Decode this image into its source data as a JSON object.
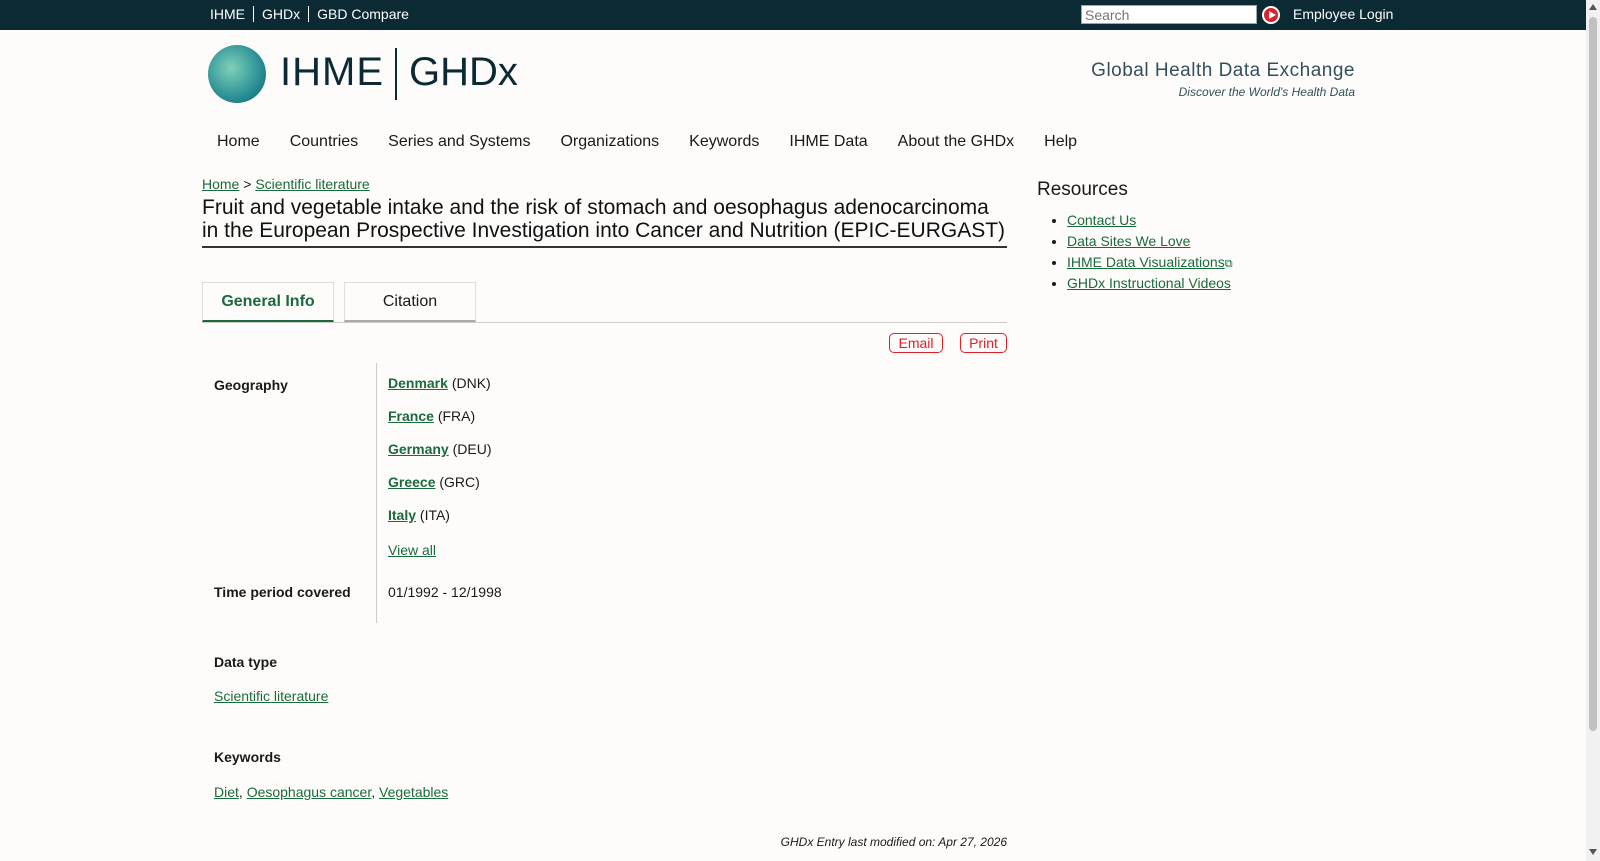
{
  "topbar": {
    "links": [
      "IHME",
      "GHDx",
      "GBD Compare"
    ],
    "search_placeholder": "Search",
    "login": "Employee Login"
  },
  "header": {
    "logo_ihme": "IHME",
    "logo_ghdx": "GHDx",
    "tagline": "Global Health Data Exchange",
    "subtagline": "Discover the World's Health Data"
  },
  "nav": [
    "Home",
    "Countries",
    "Series and Systems",
    "Organizations",
    "Keywords",
    "IHME Data",
    "About the GHDx",
    "Help"
  ],
  "breadcrumb": {
    "home": "Home",
    "sep": ">",
    "section": "Scientific literature"
  },
  "title": "Fruit and vegetable intake and the risk of stomach and oesophagus adenocarcinoma in the European Prospective Investigation into Cancer and Nutrition (EPIC-EURGAST)",
  "tabs": [
    "General Info",
    "Citation"
  ],
  "actions": {
    "email": "Email",
    "print": "Print"
  },
  "info": {
    "geography_label": "Geography",
    "geography": [
      {
        "name": "Denmark",
        "code": "(DNK)"
      },
      {
        "name": "France",
        "code": "(FRA)"
      },
      {
        "name": "Germany",
        "code": "(DEU)"
      },
      {
        "name": "Greece",
        "code": "(GRC)"
      },
      {
        "name": "Italy",
        "code": "(ITA)"
      }
    ],
    "view_all": "View all",
    "time_label": "Time period covered",
    "time_value": "01/1992 - 12/1998",
    "datatype_label": "Data type",
    "datatype_value": "Scientific literature",
    "keywords_label": "Keywords",
    "keywords": [
      "Diet",
      "Oesophagus cancer",
      "Vegetables"
    ],
    "modified": "GHDx Entry last modified on: Apr 27, 2026"
  },
  "sidebar": {
    "title": "Resources",
    "links": [
      "Contact Us",
      "Data Sites We Love",
      "IHME Data Visualizations",
      "GHDx Instructional Videos"
    ]
  }
}
